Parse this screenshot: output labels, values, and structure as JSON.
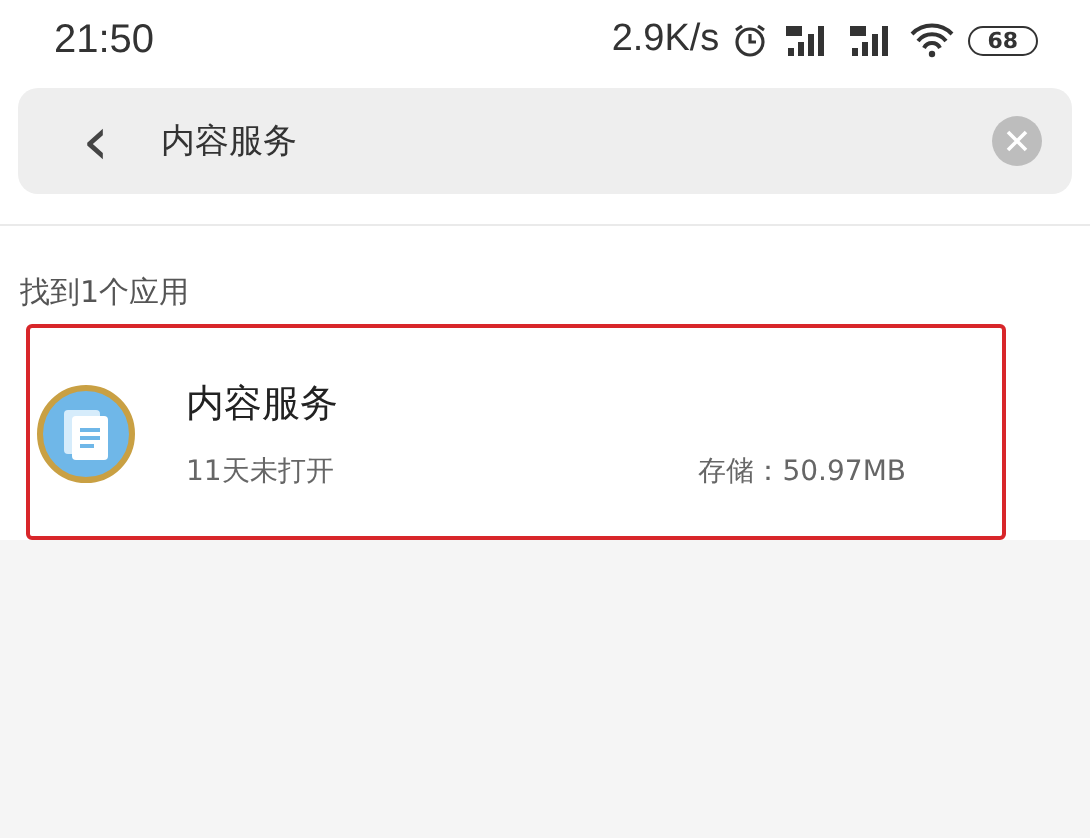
{
  "status_bar": {
    "time": "21:50",
    "speed": "2.9K/s",
    "battery": "68"
  },
  "search": {
    "back": "‹",
    "value": "内容服务"
  },
  "results": {
    "summary": "找到1个应用",
    "apps": [
      {
        "name": "内容服务",
        "last_opened": "11天未打开",
        "storage": "存储：50.97MB",
        "highlighted": true
      }
    ]
  }
}
